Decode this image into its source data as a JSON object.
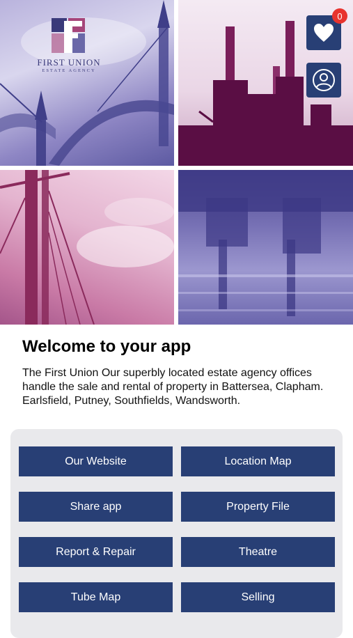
{
  "brand": {
    "name": "FIRST UNION",
    "tagline": "ESTATE AGENCY"
  },
  "header": {
    "favourites_count": "0"
  },
  "welcome": {
    "title": "Welcome to your app",
    "text": "The First Union Our superbly located estate agency offices handle the sale and rental of property in Battersea, Clapham. Earlsfield, Putney, Southfields, Wandsworth."
  },
  "menu": {
    "items": [
      {
        "label": "Our Website"
      },
      {
        "label": "Location Map"
      },
      {
        "label": "Share app"
      },
      {
        "label": "Property File"
      },
      {
        "label": "Report & Repair"
      },
      {
        "label": "Theatre"
      },
      {
        "label": "Tube Map"
      },
      {
        "label": "Selling"
      }
    ]
  },
  "colors": {
    "primary": "#283f75",
    "badge": "#e8332e",
    "panel": "#e9e9ec"
  },
  "icons": {
    "favourites": "heart-icon",
    "profile": "user-icon"
  }
}
